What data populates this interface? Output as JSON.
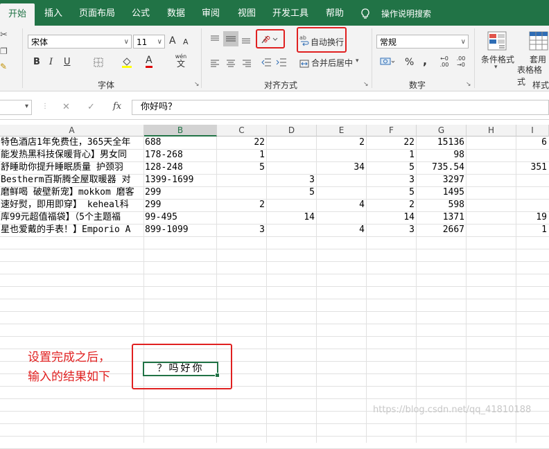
{
  "tabs": [
    "开始",
    "插入",
    "页面布局",
    "公式",
    "数据",
    "审阅",
    "视图",
    "开发工具",
    "帮助",
    "操作说明搜索"
  ],
  "font": {
    "name": "宋体",
    "size": "11",
    "grow": "A",
    "shrink": "A",
    "bold": "B",
    "italic": "I",
    "underline": "U",
    "color_a": "A",
    "wen": "wén",
    "wen_char": "文"
  },
  "align": {
    "wrap_text": "自动换行",
    "merge_center": "合并后居中"
  },
  "number": {
    "format": "常规",
    "percent": "%",
    "comma": ",",
    "inc_decimal": "←0 .00",
    "dec_decimal": ".00 →0"
  },
  "styles": {
    "conditional": "条件格式",
    "table_fmt_1": "套用",
    "table_fmt_2": "表格格式",
    "styles_label": "样式"
  },
  "groups": {
    "font": "字体",
    "alignment": "对齐方式",
    "number": "数字"
  },
  "formula": {
    "fx": "fx",
    "cancel": "✕",
    "enter": "✓",
    "content": "你好吗？"
  },
  "columns": [
    "A",
    "B",
    "C",
    "D",
    "E",
    "F",
    "G",
    "H",
    "I"
  ],
  "rows": [
    [
      "特色酒店1年免费住，365天全年",
      "688",
      "22",
      "",
      "2",
      "22",
      "15136",
      "",
      "6"
    ],
    [
      "能发热黑科技保暖背心】男女同",
      "178-268",
      "1",
      "",
      "",
      "1",
      "98",
      "",
      ""
    ],
    [
      "舒睡助你提升睡眠质量 护颈羽",
      "128-248",
      "5",
      "",
      "34",
      "5",
      "735.54",
      "",
      "351"
    ],
    [
      "Bestherm百斯腾全屋取暖器 对",
      "1399-1699",
      "",
      "3",
      "",
      "3",
      "3297",
      "",
      ""
    ],
    [
      "磨鲜喝 破壁新宠】mokkom 磨客",
      "299",
      "",
      "5",
      "",
      "5",
      "1495",
      "",
      ""
    ],
    [
      "速好熨，即用即穿】 keheal科",
      "299",
      "2",
      "",
      "4",
      "2",
      "598",
      "",
      ""
    ],
    [
      "库99元超值福袋】（5个主题福",
      "99-495",
      "",
      "14",
      "",
      "14",
      "1371",
      "",
      "19"
    ],
    [
      "星也爱戴的手表！】Emporio A",
      "899-1099",
      "3",
      "",
      "4",
      "3",
      "2667",
      "",
      "1"
    ]
  ],
  "result_cell": "？吗好你",
  "annotation": [
    "设置完成之后，",
    "输入的结果如下"
  ],
  "watermark": "https://blog.csdn.net/qq_41810188",
  "colors": {
    "brand": "#217346",
    "annotation": "#e02020"
  }
}
